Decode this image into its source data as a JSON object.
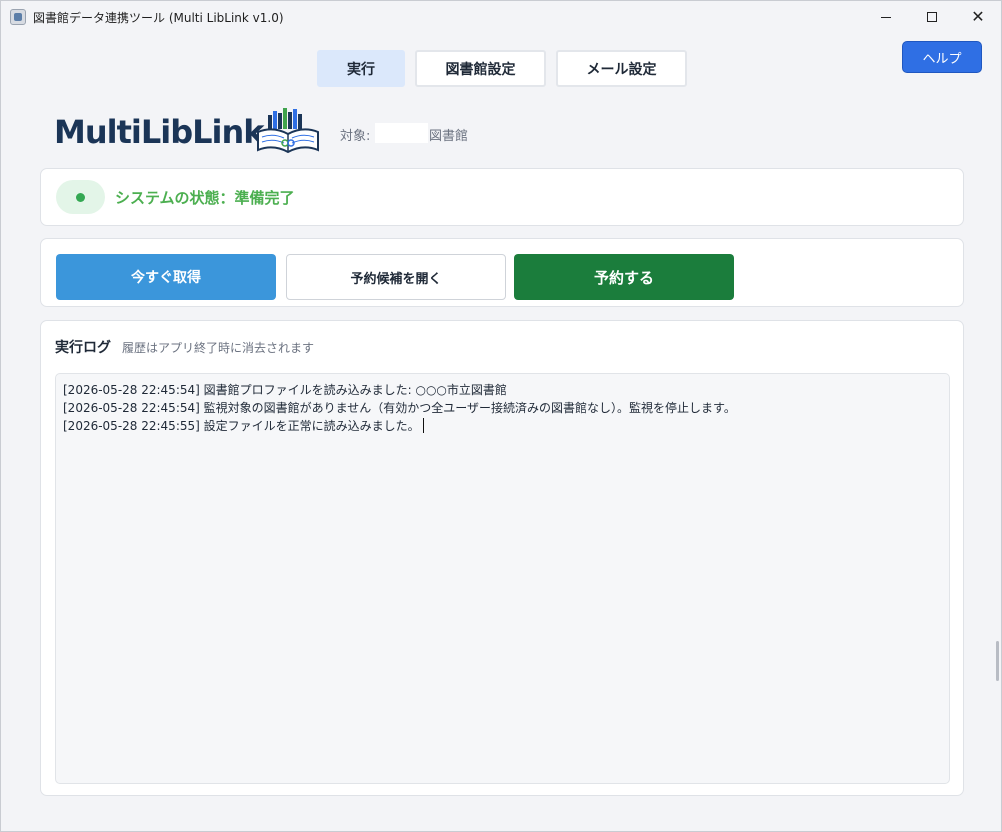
{
  "window": {
    "title": "図書館データ連携ツール (Multi LibLink v1.0)"
  },
  "tabs": [
    {
      "label": "実行",
      "active": true
    },
    {
      "label": "図書館設定",
      "active": false
    },
    {
      "label": "メール設定",
      "active": false
    }
  ],
  "help_label": "ヘルプ",
  "logo": {
    "text": "MultiLibLink",
    "icon": "books-logo-icon"
  },
  "target": {
    "prefix": "対象:",
    "suffix": "図書館"
  },
  "status": {
    "text": "システムの状態：準備完了",
    "color": "#4caf50"
  },
  "actions": {
    "fetch_now": "今すぐ取得",
    "open_candidates": "予約候補を開く",
    "reserve": "予約する"
  },
  "log": {
    "title": "実行ログ",
    "subtitle": "履歴はアプリ終了時に消去されます",
    "lines": [
      "[2026-05-28 22:45:54] 図書館プロファイルを読み込みました: ○○○市立図書館",
      "[2026-05-28 22:45:54] 監視対象の図書館がありません（有効かつ全ユーザー接続済みの図書館なし）。監視を停止します。",
      "[2026-05-28 22:45:55] 設定ファイルを正常に読み込みました。"
    ]
  },
  "colors": {
    "accent": "#2f6fe4",
    "fetch_button": "#3b96db",
    "reserve_button": "#1b7d3c",
    "logo_text": "#1b3557"
  }
}
